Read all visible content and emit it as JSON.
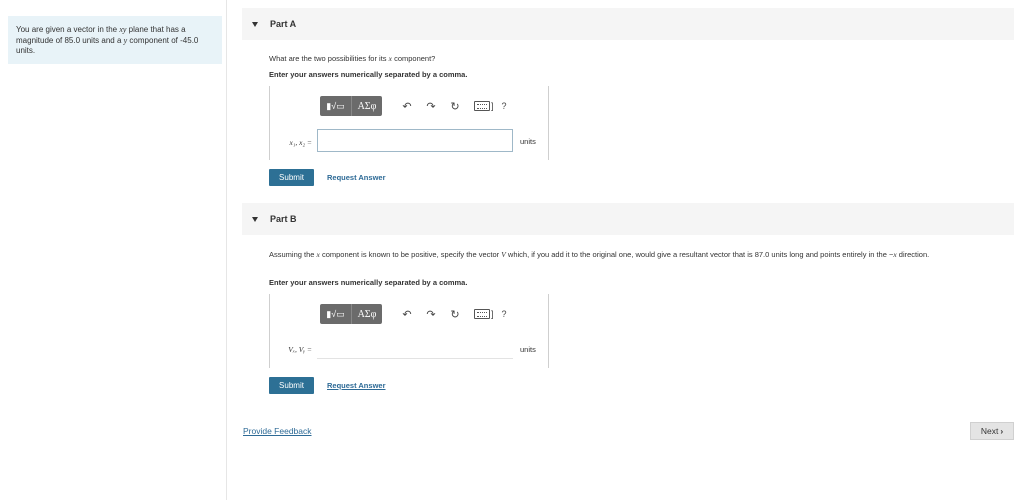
{
  "problem": {
    "text_1": "You are given a vector in the ",
    "text_var": "xy",
    "text_2": " plane that has a magnitude of 85.0 units and a ",
    "text_var2": "y",
    "text_3": " component of -45.0 units."
  },
  "partA": {
    "header": "Part A",
    "question_1": "What are the two possibilities for its ",
    "question_var": "x",
    "question_2": " component?",
    "instruction": "Enter your answers numerically separated by a comma.",
    "var_label": "x₁, x₂ =",
    "input_value": "",
    "units": "units",
    "submit_label": "Submit",
    "request_label": "Request Answer"
  },
  "partB": {
    "header": "Part B",
    "question_1": "Assuming the ",
    "question_var": "x",
    "question_2": " component is known to be positive, specify the vector ",
    "question_vec": "V",
    "question_3": " which, if you add it to the original one, would give a resultant vector that is 87.0 units long and points entirely in the −",
    "question_var2": "x",
    "question_4": " direction.",
    "instruction": "Enter your answers numerically separated by a comma.",
    "var_label": "Vₓ, Vᵧ =",
    "input_value": "",
    "units": "units",
    "submit_label": "Submit",
    "request_label": "Request Answer"
  },
  "toolbar": {
    "template_label": "▮√▭",
    "symbols_label": "ΑΣφ",
    "undo_icon": "↶",
    "redo_icon": "↷",
    "reset_icon": "↻",
    "keyboard_bracket": "]",
    "help_label": "?"
  },
  "footer": {
    "feedback_label": "Provide Feedback",
    "next_label": "Next",
    "next_chevron": "›"
  }
}
